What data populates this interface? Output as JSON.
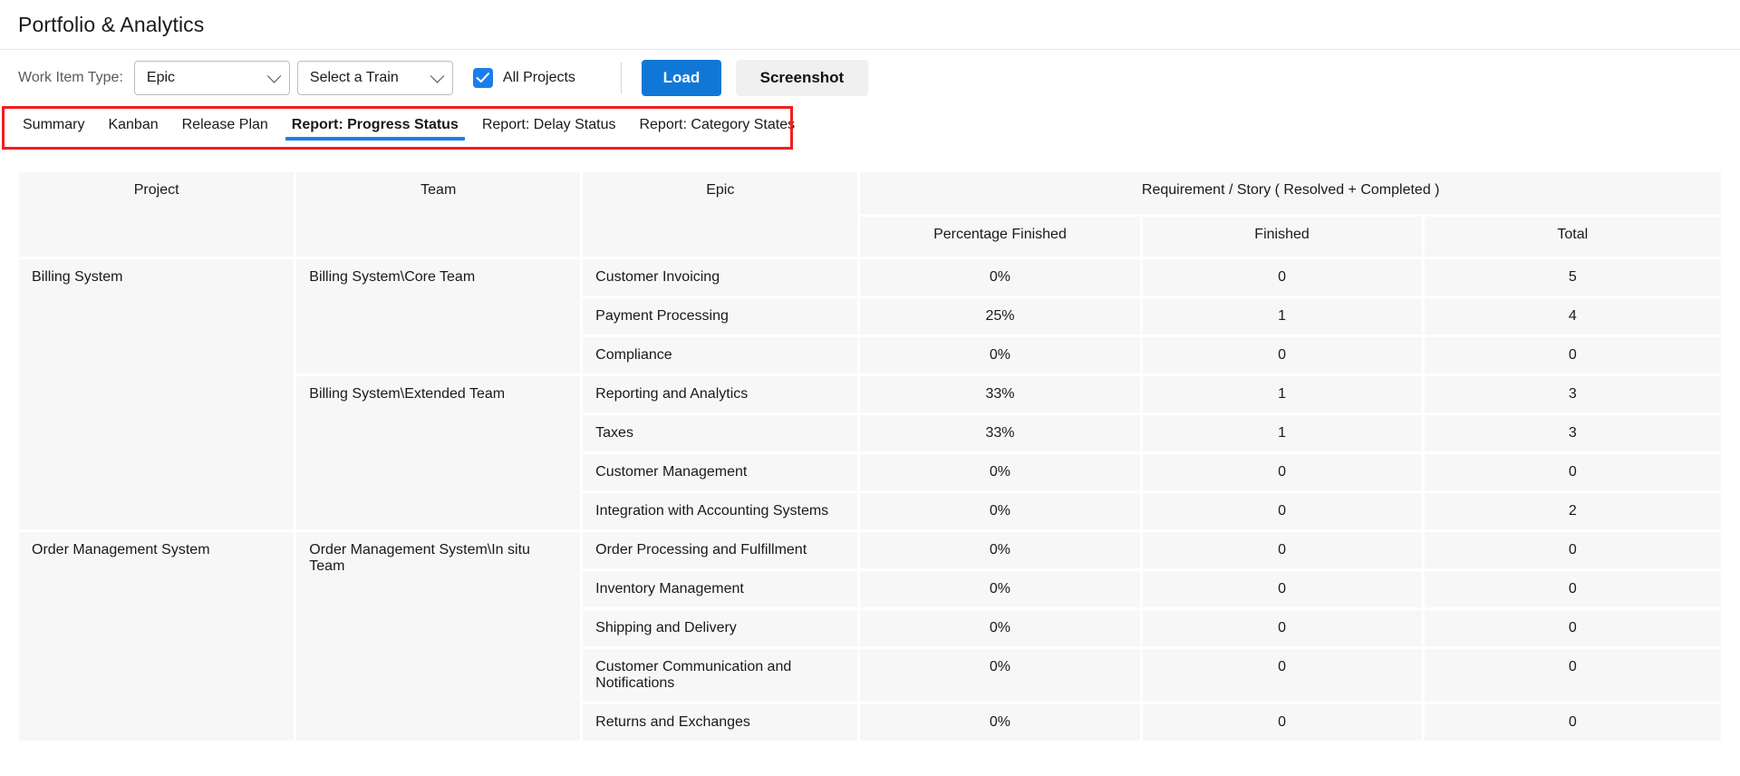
{
  "header": {
    "title": "Portfolio & Analytics"
  },
  "toolbar": {
    "work_item_type_label": "Work Item Type:",
    "work_item_type_value": "Epic",
    "train_value": "Select a Train",
    "all_projects_label": "All Projects",
    "all_projects_checked": true,
    "load_label": "Load",
    "screenshot_label": "Screenshot",
    "accent_color": "#1177d6",
    "checkbox_color": "#1b7ced"
  },
  "tabs": {
    "items": [
      {
        "label": "Summary",
        "active": false
      },
      {
        "label": "Kanban",
        "active": false
      },
      {
        "label": "Release Plan",
        "active": false
      },
      {
        "label": "Report: Progress Status",
        "active": true
      },
      {
        "label": "Report: Delay Status",
        "active": false
      },
      {
        "label": "Report: Category States",
        "active": false
      }
    ],
    "highlight_color": "#f41d1d",
    "active_underline_color": "#1b7ced"
  },
  "table": {
    "headers": {
      "project": "Project",
      "team": "Team",
      "epic": "Epic",
      "group": "Requirement / Story ( Resolved + Completed )",
      "percentage_finished": "Percentage Finished",
      "finished": "Finished",
      "total": "Total"
    },
    "rows": [
      {
        "project": "Billing System",
        "project_rowspan": 7,
        "team": "Billing System\\Core Team",
        "team_rowspan": 3,
        "epic": "Customer Invoicing",
        "percentage": "0%",
        "finished": "0",
        "total": "5"
      },
      {
        "epic": "Payment Processing",
        "percentage": "25%",
        "finished": "1",
        "total": "4"
      },
      {
        "epic": "Compliance",
        "percentage": "0%",
        "finished": "0",
        "total": "0"
      },
      {
        "team": "Billing System\\Extended Team",
        "team_rowspan": 4,
        "epic": "Reporting and Analytics",
        "percentage": "33%",
        "finished": "1",
        "total": "3"
      },
      {
        "epic": "Taxes",
        "percentage": "33%",
        "finished": "1",
        "total": "3"
      },
      {
        "epic": "Customer Management",
        "percentage": "0%",
        "finished": "0",
        "total": "0"
      },
      {
        "epic": "Integration with Accounting Systems",
        "percentage": "0%",
        "finished": "0",
        "total": "2"
      },
      {
        "project": "Order Management System",
        "project_rowspan": 5,
        "team": "Order Management System\\In situ Team",
        "team_rowspan": 5,
        "epic": "Order Processing and Fulfillment",
        "percentage": "0%",
        "finished": "0",
        "total": "0"
      },
      {
        "epic": "Inventory Management",
        "percentage": "0%",
        "finished": "0",
        "total": "0"
      },
      {
        "epic": "Shipping and Delivery",
        "percentage": "0%",
        "finished": "0",
        "total": "0"
      },
      {
        "epic": "Customer Communication and Notifications",
        "percentage": "0%",
        "finished": "0",
        "total": "0"
      },
      {
        "epic": "Returns and Exchanges",
        "percentage": "0%",
        "finished": "0",
        "total": "0"
      }
    ]
  }
}
